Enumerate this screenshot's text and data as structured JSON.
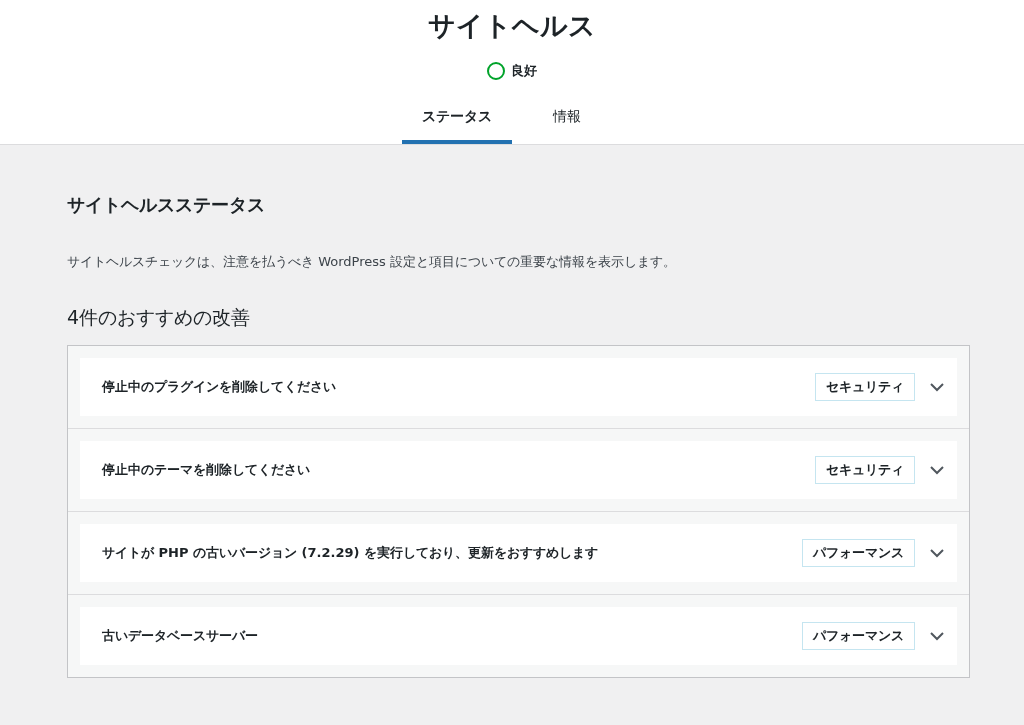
{
  "header": {
    "title": "サイトヘルス",
    "status": {
      "label": "良好",
      "color": "#00a32a"
    }
  },
  "tabs": [
    {
      "label": "ステータス",
      "selected": true
    },
    {
      "label": "情報",
      "selected": false
    }
  ],
  "section": {
    "title": "サイトヘルスステータス",
    "description": "サイトヘルスチェックは、注意を払うべき WordPress 設定と項目についての重要な情報を表示します。",
    "count_heading": "4件のおすすめの改善"
  },
  "issues": [
    {
      "title": "停止中のプラグインを削除してください",
      "badge": "セキュリティ",
      "expanded": false
    },
    {
      "title": "停止中のテーマを削除してください",
      "badge": "セキュリティ",
      "expanded": false
    },
    {
      "title": "サイトが PHP の古いバージョン (7.2.29) を実行しており、更新をおすすめします",
      "badge": "パフォーマンス",
      "expanded": false
    },
    {
      "title": "古いデータベースサーバー",
      "badge": "パフォーマンス",
      "expanded": false
    }
  ]
}
